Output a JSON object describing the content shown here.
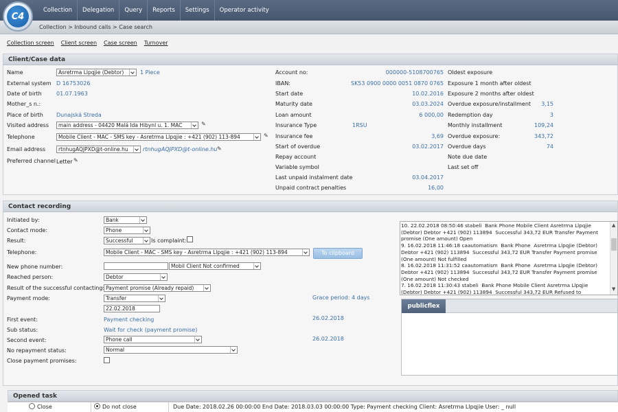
{
  "app": {
    "logo_text": "C4"
  },
  "nav": [
    "Collection",
    "Delegation",
    "Query",
    "Reports",
    "Settings",
    "Operator activity"
  ],
  "breadcrumb": "Collection > Inbound calls > Case search",
  "subnav": [
    "Collection screen",
    "Client screen",
    "Case screen",
    "Turnover"
  ],
  "client": {
    "title": "Client/Case data",
    "name_label": "Name",
    "name_value": "Asretrma Llpqjie (Debtor)",
    "pieces": "1 Piece",
    "external_label": "External system",
    "external_value": "D 16753026",
    "dob_label": "Date of birth",
    "dob_value": "01.07.1963",
    "mother_label": "Mother_s n.:",
    "pob_label": "Place of birth",
    "pob_value": "Dunajská Streda",
    "visited_label": "Visited address",
    "visited_value": "main address - 04420 Malá Ida Hibynl u. 1. MAC",
    "tel_label": "Telephone",
    "tel_value": "Mobile Client - MAC - SMS key - Asretrma Llpqjie : +421 (902) 113-894",
    "email_label": "Email address",
    "email_value": "rtnhugAQJPXD@t-online.hu",
    "email_link": "rtnhugAQJPXD@t-online.hu",
    "channel_label": "Preferred channel",
    "channel_value": "Letter"
  },
  "account": {
    "labels": [
      "Account no:",
      "IBAN:",
      "Start date",
      "Maturity date",
      "Loan amount",
      "Insurance Type",
      "Insurance fee",
      "Start of overdue",
      "Repay account",
      "Variable symbol",
      "Last unpaid instalment date",
      "Unpaid contract penalties"
    ],
    "account_no": "000000-5108700765",
    "iban": "SK53 0900 0000 0051 0870 0765",
    "start_date": "10.02.2016",
    "maturity_date": "03.03.2024",
    "loan_amount": "6 000,00",
    "insurance_type": "1RSU",
    "insurance_fee": "3,69",
    "start_overdue": "03.02.2017",
    "last_unpaid": "03.04.2017",
    "penalties": "16,00"
  },
  "exposure": {
    "labels": [
      "Oldest exposure",
      "Exposure 1 month after oldest",
      "Exposure 2 months after oldest",
      "Overdue exposure/installment",
      "Redemption day",
      "Monthly installment",
      "Overdue exposure:",
      "Overdue days",
      "Note due date",
      "Last set off"
    ],
    "overdue_installment": "3,15",
    "redemption_day": "3",
    "monthly_installment": "109,24",
    "overdue_exposure": "343,72",
    "overdue_days": "74"
  },
  "contact": {
    "title": "Contact recording",
    "initiated_label": "Initiated by:",
    "initiated_value": "Bank",
    "mode_label": "Contact mode:",
    "mode_value": "Phone",
    "result_label": "Result:",
    "result_value": "Successful",
    "complaint_label": "Is complaint:",
    "tel_label": "Telephone:",
    "tel_value": "Mobile Client - MAC - SMS key - Asretrma Llpqjie : +421 (902) 113-894",
    "clipboard_button": "To clipboard",
    "new_phone_label": "New phone number:",
    "new_phone_type": "Mobil Client Not confirmed",
    "reached_label": "Reached person:",
    "reached_value": "Debtor",
    "result_success_label": "Result of the successful contacting:",
    "result_success_value": "Payment promise (Already repaid)",
    "payment_mode_label": "Payment mode:",
    "payment_mode_value": "Transfer",
    "payment_date": "22.02.2018",
    "grace_period": "Grace period: 4 days",
    "first_event_label": "First event:",
    "first_event_value": "Payment checking",
    "first_event_date": "26.02.2018",
    "sub_status_label": "Sub status:",
    "sub_status_value": "Wait for check (payment promise)",
    "second_event_label": "Second event:",
    "second_event_value": "Phone call",
    "second_event_date": "26.02.2018",
    "no_repay_label": "No repayment status:",
    "no_repay_value": "Normal",
    "close_promises_label": "Close payment promises:"
  },
  "log_text": "10. 22.02.2018 08:50:46 stabeli  Bank Phone Mobile Client Asretrma Llpqjie (Debtor) Debtor +421 (902) 113894  Successful 343,72 EUR Transfer Payment promise (One amount) Open\n9. 16.02.2018 11:46:18 caautomatism  Bank Phone  Asretrma Llpqjie (Debtor) Debtor +421 (902) 113894  Successful 343,72 EUR Transfer Payment promise (One amount) Not fulfilled\n8. 16.02.2018 11:31:52 caautomatism  Bank Phone  Asretrma Llpqjie (Debtor) Debtor +421 (902) 113894  Successful 343,72 EUR Transfer Payment promise (One amount) Not checked\n7. 16.02.2018 11:30:43 stabeli  Bank Phone Mobile Client Asretrma Llpqjie (Debtor) Debtor +421 (902) 113894  Successful 343,72 EUR Refused to",
  "publicflex": {
    "tab": "publicflex"
  },
  "task": {
    "title": "Opened task",
    "close_label": "Close",
    "not_close_label": "Do not close",
    "details": "Due Date: 2018.02.26 00:00:00 End Date: 2018.03.03 00:00:00 Type: Payment checking Client: Asretrma Llpqjie User: _ null"
  }
}
